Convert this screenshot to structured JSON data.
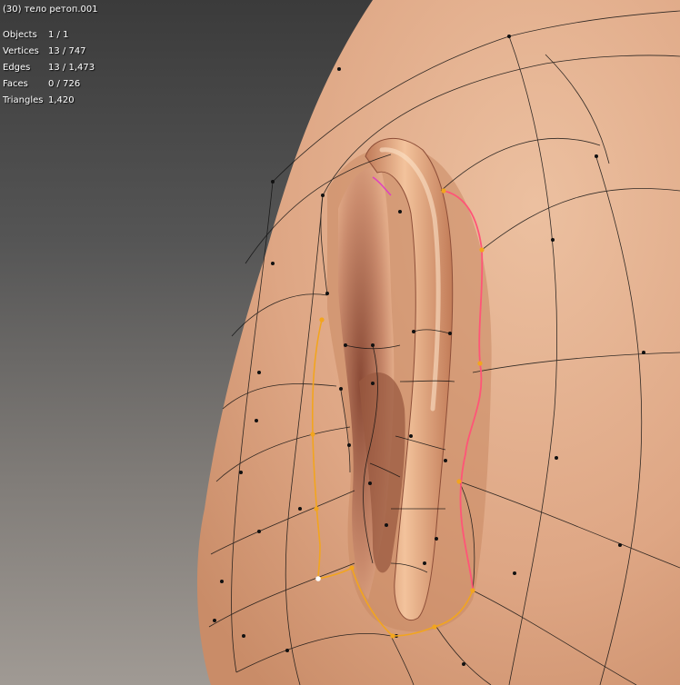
{
  "viewport": {
    "object_title": "(30) тело ретоп.001",
    "stats": [
      {
        "label": "Objects",
        "value": "1 / 1"
      },
      {
        "label": "Vertices",
        "value": "13 / 747"
      },
      {
        "label": "Edges",
        "value": "13 / 1,473"
      },
      {
        "label": "Faces",
        "value": "0 / 726"
      },
      {
        "label": "Triangles",
        "value": "1,420"
      }
    ]
  },
  "colors": {
    "skin": "#e0a883",
    "wire": "#111111",
    "selected_edge": "#f2a51e",
    "active_edge": "#ff5577",
    "active_vertex": "#ffffff"
  }
}
